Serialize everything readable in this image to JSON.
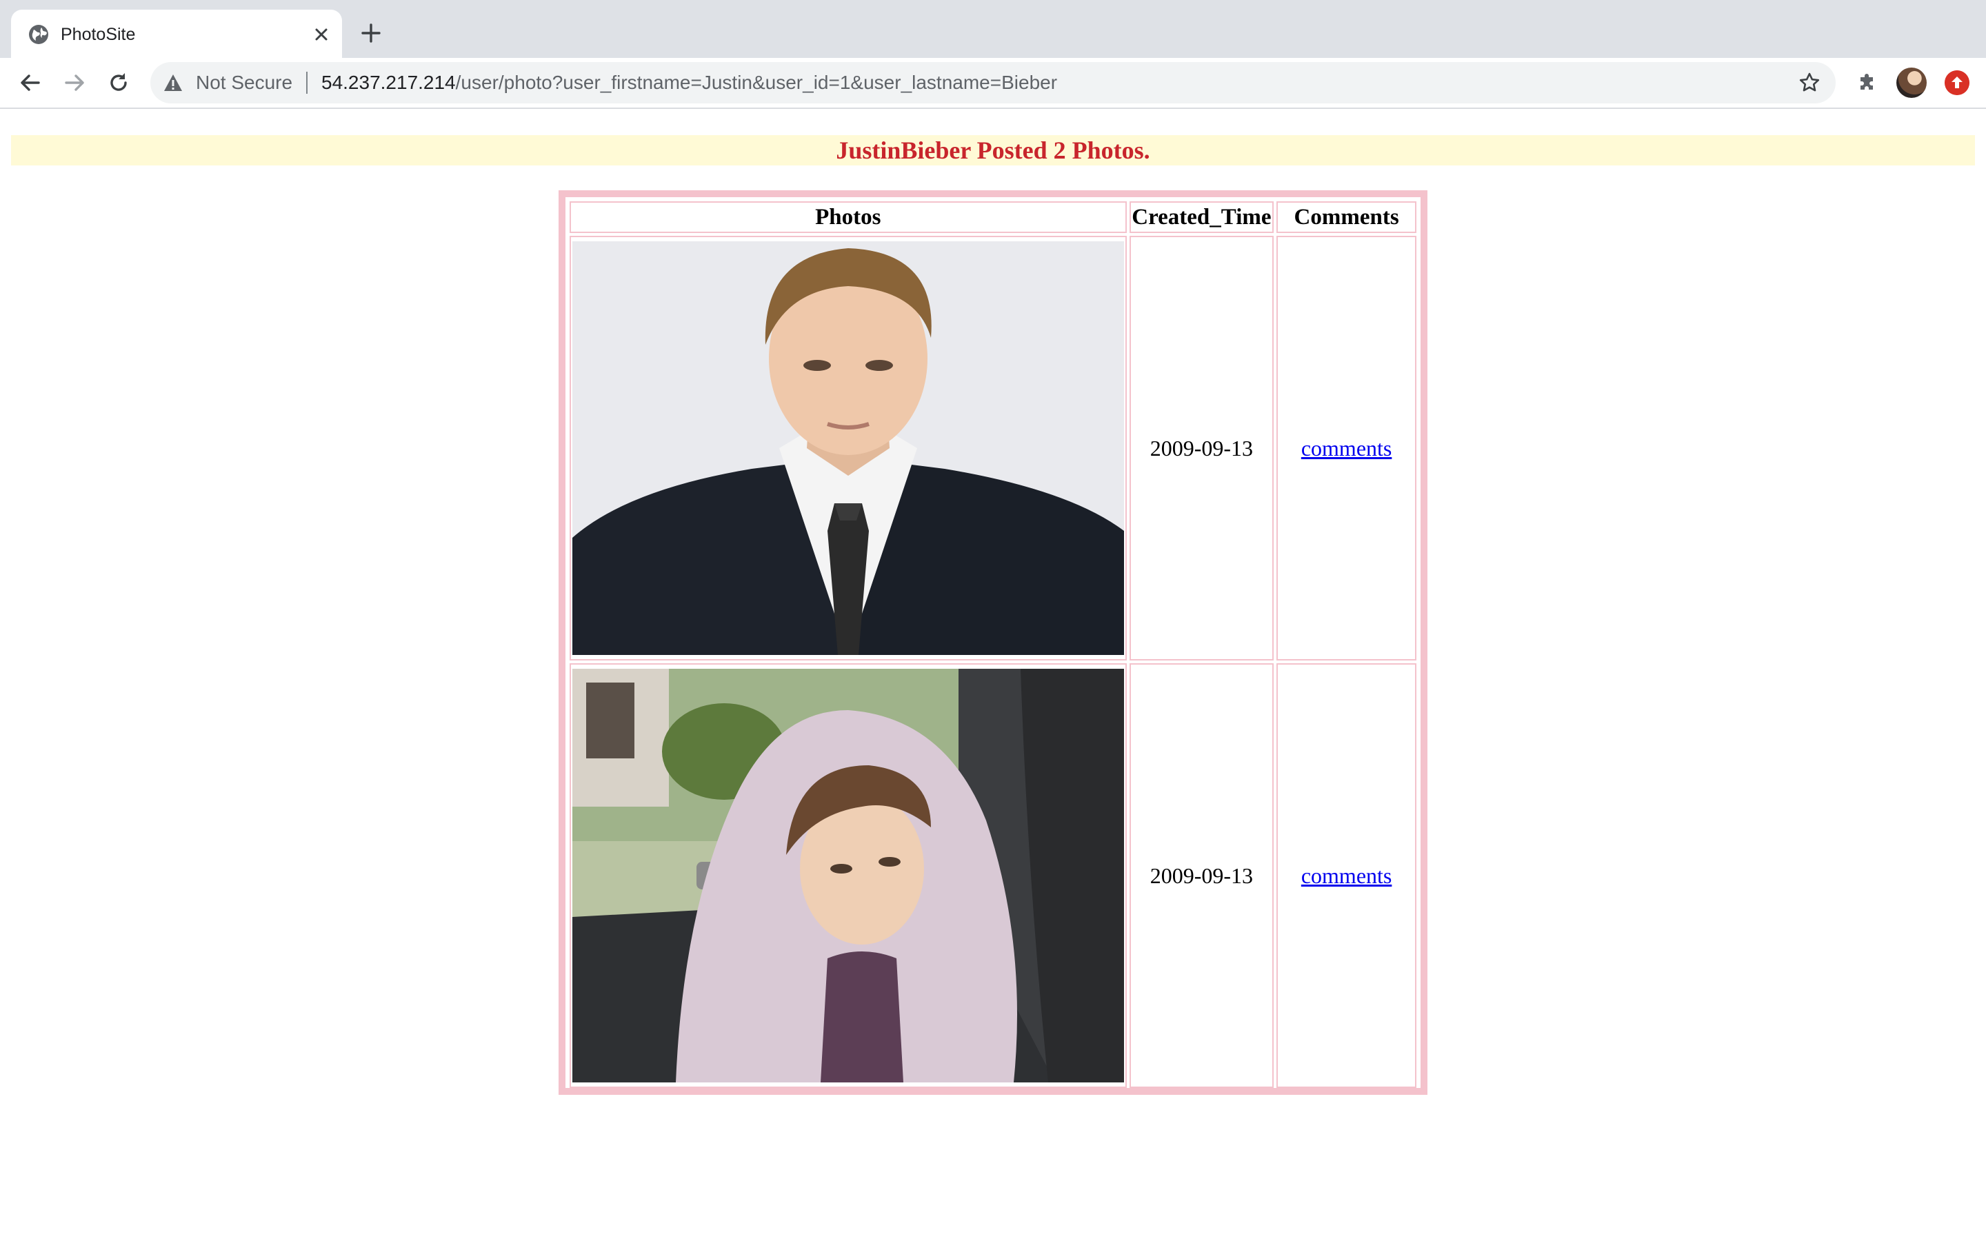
{
  "browser": {
    "tab_title": "PhotoSite",
    "security_label": "Not Secure",
    "url_host": "54.237.217.214",
    "url_path": "/user/photo?user_firstname=Justin&user_id=1&user_lastname=Bieber"
  },
  "page": {
    "heading": "JustinBieber Posted 2 Photos.",
    "table": {
      "headers": [
        "Photos",
        "Created_Time",
        "Comments"
      ],
      "rows": [
        {
          "photo": "Justin Bieber photo 1",
          "created_time": "2009-09-13",
          "comments_link": "comments"
        },
        {
          "photo": "Justin Bieber photo 2",
          "created_time": "2009-09-13",
          "comments_link": "comments"
        }
      ]
    }
  },
  "colors": {
    "heading": "#c8252c",
    "banner_bg": "#fffad6",
    "table_border": "#f4c2cc",
    "link": "#0000ee"
  }
}
